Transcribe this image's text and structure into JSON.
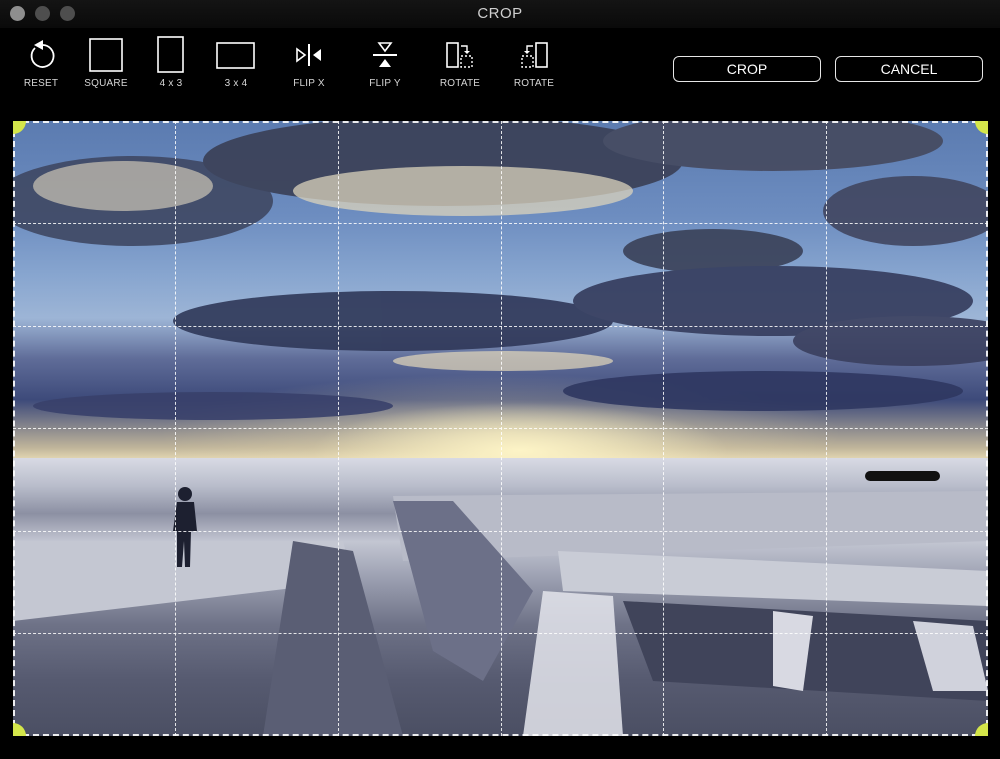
{
  "window": {
    "title": "CROP",
    "controls": [
      "close",
      "minimize",
      "maximize"
    ]
  },
  "toolbar": {
    "tools": [
      {
        "id": "reset",
        "label": "RESET",
        "icon": "reset-icon"
      },
      {
        "id": "square",
        "label": "SQUARE",
        "icon": "square-ratio-icon"
      },
      {
        "id": "4x3",
        "label": "4 x 3",
        "icon": "portrait-ratio-icon"
      },
      {
        "id": "3x4",
        "label": "3 x 4",
        "icon": "landscape-ratio-icon"
      },
      {
        "id": "flip-x",
        "label": "FLIP X",
        "icon": "flip-horizontal-icon"
      },
      {
        "id": "flip-y",
        "label": "FLIP Y",
        "icon": "flip-vertical-icon"
      },
      {
        "id": "rotate-right",
        "label": "ROTATE",
        "icon": "rotate-right-icon"
      },
      {
        "id": "rotate-left",
        "label": "ROTATE",
        "icon": "rotate-left-icon"
      }
    ],
    "crop_label": "CROP",
    "cancel_label": "CANCEL"
  },
  "crop_area": {
    "grid_divisions": 6,
    "handle_color": "#d4e64a",
    "image_description": "Man standing on a cliff edge over a vast canyon of flat-topped plateaus under a dramatic cloudy sky"
  }
}
